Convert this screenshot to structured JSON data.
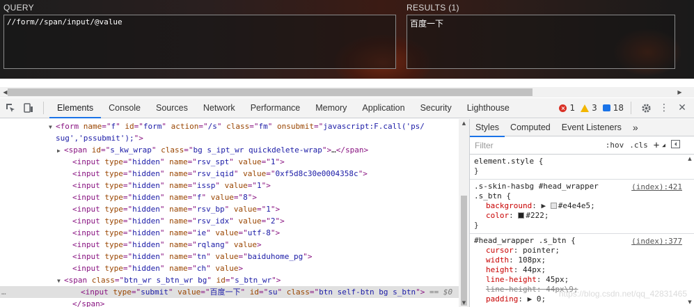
{
  "xpath_helper": {
    "query_label": "QUERY",
    "results_label": "RESULTS (1)",
    "query_value": "//form//span/input/@value",
    "result_value": "百度一下"
  },
  "devtools": {
    "tabs": [
      {
        "label": "Elements",
        "active": true
      },
      {
        "label": "Console"
      },
      {
        "label": "Sources"
      },
      {
        "label": "Network"
      },
      {
        "label": "Performance"
      },
      {
        "label": "Memory"
      },
      {
        "label": "Application"
      },
      {
        "label": "Security"
      },
      {
        "label": "Lighthouse"
      }
    ],
    "badges": {
      "errors": "1",
      "warnings": "3",
      "info": "18"
    },
    "icons": [
      "inspect-icon",
      "device-toggle-icon",
      "gear-icon",
      "kebab-menu-icon",
      "close-icon"
    ]
  },
  "elements": {
    "lines": [
      {
        "indent": 80,
        "tri": "▼",
        "parts": [
          [
            "t",
            "<form "
          ],
          [
            "an",
            "name"
          ],
          [
            "t",
            "=\""
          ],
          [
            "av",
            "f"
          ],
          [
            "t",
            "\" "
          ],
          [
            "an",
            "id"
          ],
          [
            "t",
            "=\""
          ],
          [
            "av",
            "form"
          ],
          [
            "t",
            "\" "
          ],
          [
            "an",
            "action"
          ],
          [
            "t",
            "=\""
          ],
          [
            "av",
            "/s"
          ],
          [
            "t",
            "\" "
          ],
          [
            "an",
            "class"
          ],
          [
            "t",
            "=\""
          ],
          [
            "av",
            "fm"
          ],
          [
            "t",
            "\" "
          ],
          [
            "an",
            "onsubmit"
          ],
          [
            "t",
            "=\""
          ],
          [
            "av",
            "javascript:F.call('ps/"
          ]
        ]
      },
      {
        "indent": 80,
        "tri": "",
        "parts": [
          [
            "av",
            "sug','pssubmit');"
          ],
          [
            "t",
            "\">"
          ]
        ]
      },
      {
        "indent": 92,
        "tri": "▶",
        "parts": [
          [
            "t",
            "<span "
          ],
          [
            "an",
            "id"
          ],
          [
            "t",
            "=\""
          ],
          [
            "av",
            "s_kw_wrap"
          ],
          [
            "t",
            "\" "
          ],
          [
            "an",
            "class"
          ],
          [
            "t",
            "=\""
          ],
          [
            "av",
            "bg s_ipt_wr quickdelete-wrap"
          ],
          [
            "t",
            "\">"
          ],
          [
            "txt",
            "…"
          ],
          [
            "t",
            "</span>"
          ]
        ]
      },
      {
        "indent": 104,
        "tri": "",
        "parts": [
          [
            "t",
            "<input "
          ],
          [
            "an",
            "type"
          ],
          [
            "t",
            "=\""
          ],
          [
            "av",
            "hidden"
          ],
          [
            "t",
            "\" "
          ],
          [
            "an",
            "name"
          ],
          [
            "t",
            "=\""
          ],
          [
            "av",
            "rsv_spt"
          ],
          [
            "t",
            "\" "
          ],
          [
            "an",
            "value"
          ],
          [
            "t",
            "=\""
          ],
          [
            "av",
            "1"
          ],
          [
            "t",
            "\">"
          ]
        ]
      },
      {
        "indent": 104,
        "tri": "",
        "parts": [
          [
            "t",
            "<input "
          ],
          [
            "an",
            "type"
          ],
          [
            "t",
            "=\""
          ],
          [
            "av",
            "hidden"
          ],
          [
            "t",
            "\" "
          ],
          [
            "an",
            "name"
          ],
          [
            "t",
            "=\""
          ],
          [
            "av",
            "rsv_iqid"
          ],
          [
            "t",
            "\" "
          ],
          [
            "an",
            "value"
          ],
          [
            "t",
            "=\""
          ],
          [
            "av",
            "0xf5d8c30e0004358c"
          ],
          [
            "t",
            "\">"
          ]
        ]
      },
      {
        "indent": 104,
        "tri": "",
        "parts": [
          [
            "t",
            "<input "
          ],
          [
            "an",
            "type"
          ],
          [
            "t",
            "=\""
          ],
          [
            "av",
            "hidden"
          ],
          [
            "t",
            "\" "
          ],
          [
            "an",
            "name"
          ],
          [
            "t",
            "=\""
          ],
          [
            "av",
            "issp"
          ],
          [
            "t",
            "\" "
          ],
          [
            "an",
            "value"
          ],
          [
            "t",
            "=\""
          ],
          [
            "av",
            "1"
          ],
          [
            "t",
            "\">"
          ]
        ]
      },
      {
        "indent": 104,
        "tri": "",
        "parts": [
          [
            "t",
            "<input "
          ],
          [
            "an",
            "type"
          ],
          [
            "t",
            "=\""
          ],
          [
            "av",
            "hidden"
          ],
          [
            "t",
            "\" "
          ],
          [
            "an",
            "name"
          ],
          [
            "t",
            "=\""
          ],
          [
            "av",
            "f"
          ],
          [
            "t",
            "\" "
          ],
          [
            "an",
            "value"
          ],
          [
            "t",
            "=\""
          ],
          [
            "av",
            "8"
          ],
          [
            "t",
            "\">"
          ]
        ]
      },
      {
        "indent": 104,
        "tri": "",
        "parts": [
          [
            "t",
            "<input "
          ],
          [
            "an",
            "type"
          ],
          [
            "t",
            "=\""
          ],
          [
            "av",
            "hidden"
          ],
          [
            "t",
            "\" "
          ],
          [
            "an",
            "name"
          ],
          [
            "t",
            "=\""
          ],
          [
            "av",
            "rsv_bp"
          ],
          [
            "t",
            "\" "
          ],
          [
            "an",
            "value"
          ],
          [
            "t",
            "=\""
          ],
          [
            "av",
            "1"
          ],
          [
            "t",
            "\">"
          ]
        ]
      },
      {
        "indent": 104,
        "tri": "",
        "parts": [
          [
            "t",
            "<input "
          ],
          [
            "an",
            "type"
          ],
          [
            "t",
            "=\""
          ],
          [
            "av",
            "hidden"
          ],
          [
            "t",
            "\" "
          ],
          [
            "an",
            "name"
          ],
          [
            "t",
            "=\""
          ],
          [
            "av",
            "rsv_idx"
          ],
          [
            "t",
            "\" "
          ],
          [
            "an",
            "value"
          ],
          [
            "t",
            "=\""
          ],
          [
            "av",
            "2"
          ],
          [
            "t",
            "\">"
          ]
        ]
      },
      {
        "indent": 104,
        "tri": "",
        "parts": [
          [
            "t",
            "<input "
          ],
          [
            "an",
            "type"
          ],
          [
            "t",
            "=\""
          ],
          [
            "av",
            "hidden"
          ],
          [
            "t",
            "\" "
          ],
          [
            "an",
            "name"
          ],
          [
            "t",
            "=\""
          ],
          [
            "av",
            "ie"
          ],
          [
            "t",
            "\" "
          ],
          [
            "an",
            "value"
          ],
          [
            "t",
            "=\""
          ],
          [
            "av",
            "utf-8"
          ],
          [
            "t",
            "\">"
          ]
        ]
      },
      {
        "indent": 104,
        "tri": "",
        "parts": [
          [
            "t",
            "<input "
          ],
          [
            "an",
            "type"
          ],
          [
            "t",
            "=\""
          ],
          [
            "av",
            "hidden"
          ],
          [
            "t",
            "\" "
          ],
          [
            "an",
            "name"
          ],
          [
            "t",
            "=\""
          ],
          [
            "av",
            "rqlang"
          ],
          [
            "t",
            "\" "
          ],
          [
            "an",
            "value"
          ],
          [
            "t",
            ">"
          ]
        ]
      },
      {
        "indent": 104,
        "tri": "",
        "parts": [
          [
            "t",
            "<input "
          ],
          [
            "an",
            "type"
          ],
          [
            "t",
            "=\""
          ],
          [
            "av",
            "hidden"
          ],
          [
            "t",
            "\" "
          ],
          [
            "an",
            "name"
          ],
          [
            "t",
            "=\""
          ],
          [
            "av",
            "tn"
          ],
          [
            "t",
            "\" "
          ],
          [
            "an",
            "value"
          ],
          [
            "t",
            "=\""
          ],
          [
            "av",
            "baiduhome_pg"
          ],
          [
            "t",
            "\">"
          ]
        ]
      },
      {
        "indent": 104,
        "tri": "",
        "parts": [
          [
            "t",
            "<input "
          ],
          [
            "an",
            "type"
          ],
          [
            "t",
            "=\""
          ],
          [
            "av",
            "hidden"
          ],
          [
            "t",
            "\" "
          ],
          [
            "an",
            "name"
          ],
          [
            "t",
            "=\""
          ],
          [
            "av",
            "ch"
          ],
          [
            "t",
            "\" "
          ],
          [
            "an",
            "value"
          ],
          [
            "t",
            ">"
          ]
        ]
      },
      {
        "indent": 92,
        "tri": "▼",
        "parts": [
          [
            "t",
            "<span "
          ],
          [
            "an",
            "class"
          ],
          [
            "t",
            "=\""
          ],
          [
            "av",
            "btn_wr s_btn_wr bg"
          ],
          [
            "t",
            "\" "
          ],
          [
            "an",
            "id"
          ],
          [
            "t",
            "=\""
          ],
          [
            "av",
            "s_btn_wr"
          ],
          [
            "t",
            "\">"
          ]
        ]
      },
      {
        "indent": 116,
        "tri": "",
        "selected": true,
        "parts": [
          [
            "t",
            "<input "
          ],
          [
            "an",
            "type"
          ],
          [
            "t",
            "=\""
          ],
          [
            "av",
            "submit"
          ],
          [
            "t",
            "\" "
          ],
          [
            "an",
            "value"
          ],
          [
            "t",
            "=\""
          ],
          [
            "av",
            "百度一下"
          ],
          [
            "t",
            "\" "
          ],
          [
            "an",
            "id"
          ],
          [
            "t",
            "=\""
          ],
          [
            "av",
            "su"
          ],
          [
            "t",
            "\" "
          ],
          [
            "an",
            "class"
          ],
          [
            "t",
            "=\""
          ],
          [
            "av",
            "btn self-btn bg s_btn"
          ],
          [
            "t",
            "\">"
          ],
          [
            "dollar",
            " == $0"
          ]
        ]
      },
      {
        "indent": 104,
        "tri": "",
        "parts": [
          [
            "t",
            "</span>"
          ]
        ]
      }
    ],
    "selected_marker": "…"
  },
  "styles": {
    "tabs": [
      {
        "label": "Styles",
        "active": true
      },
      {
        "label": "Computed"
      },
      {
        "label": "Event Listeners"
      },
      {
        "label": "»"
      }
    ],
    "filter_placeholder": "Filter",
    "hov": ":hov",
    "cls": ".cls",
    "plus": "+",
    "rules": [
      {
        "selector": "element.style {",
        "lines": [],
        "close": "}"
      },
      {
        "selector": ".s-skin-hasbg #head_wrapper",
        "selector2": ".s_btn {",
        "source": "(index):421",
        "lines": [
          {
            "prop": "background",
            "val": "#e4e4e5",
            "swatch": "#e4e4e5",
            "expander": true
          },
          {
            "prop": "color",
            "val": "#222",
            "swatch": "#222222"
          }
        ],
        "close": "}"
      },
      {
        "selector": "#head_wrapper .s_btn {",
        "source": "(index):377",
        "lines": [
          {
            "prop": "cursor",
            "val": "pointer"
          },
          {
            "prop": "width",
            "val": "108px"
          },
          {
            "prop": "height",
            "val": "44px"
          },
          {
            "prop": "line-height",
            "val": "45px"
          },
          {
            "prop": "line-height",
            "val": "44px\\9",
            "struck": true
          },
          {
            "prop": "padding",
            "val": "0",
            "expander": true
          }
        ]
      }
    ]
  },
  "watermark": "https://blog.csdn.net/qq_42831465"
}
